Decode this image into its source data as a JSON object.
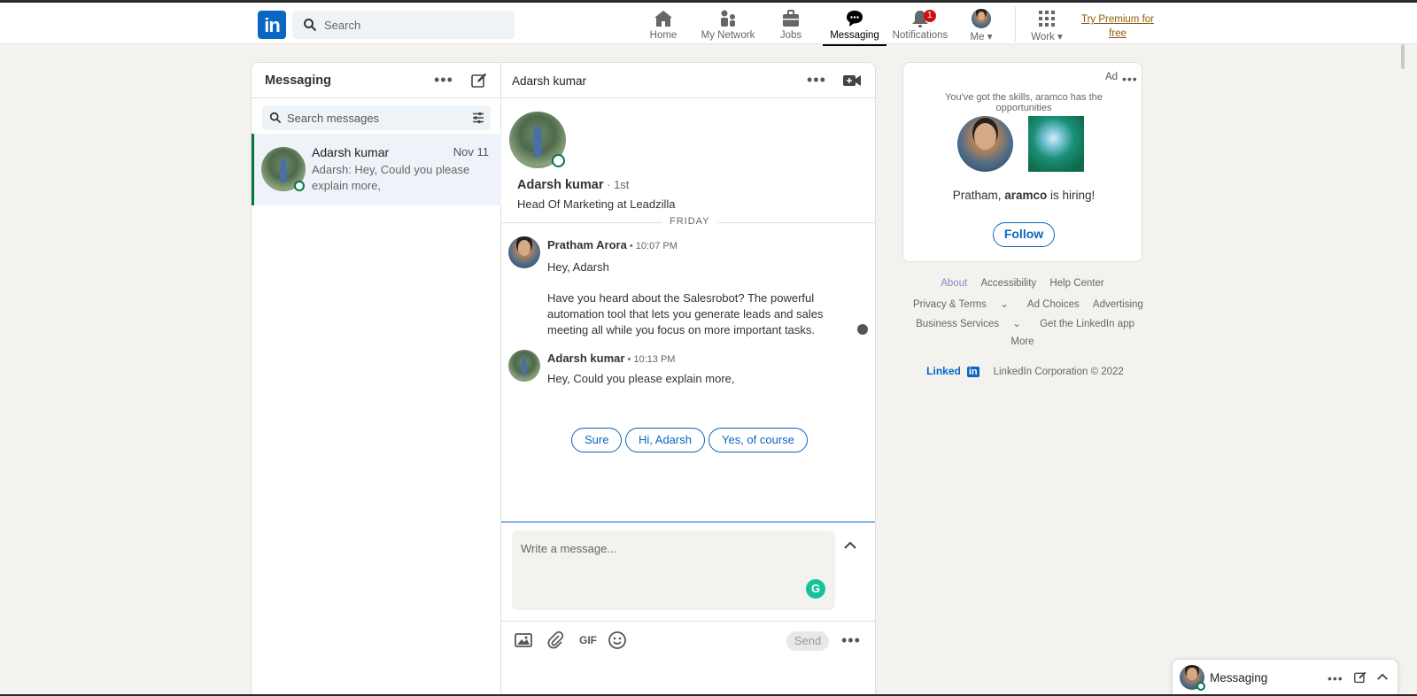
{
  "nav": {
    "search_placeholder": "Search",
    "items": [
      {
        "label": "Home",
        "icon": "home-icon"
      },
      {
        "label": "My Network",
        "icon": "network-icon"
      },
      {
        "label": "Jobs",
        "icon": "briefcase-icon"
      },
      {
        "label": "Messaging",
        "icon": "messaging-icon",
        "active": true
      },
      {
        "label": "Notifications",
        "icon": "bell-icon",
        "badge": "1"
      },
      {
        "label": "Me",
        "icon": "avatar"
      },
      {
        "label": "Work",
        "icon": "grid-icon"
      }
    ],
    "premium": "Try Premium for free"
  },
  "messaging": {
    "title": "Messaging",
    "search_placeholder": "Search messages",
    "conversations": [
      {
        "name": "Adarsh kumar",
        "date": "Nov 11",
        "snippet": "Adarsh: Hey, Could you please explain more,"
      }
    ]
  },
  "chat": {
    "title": "Adarsh kumar",
    "profile": {
      "name": "Adarsh kumar",
      "degree": " · 1st",
      "headline": "Head Of Marketing at Leadzilla"
    },
    "day": "FRIDAY",
    "messages": [
      {
        "sender": "Pratham Arora",
        "time": " • 10:07 PM",
        "lines": [
          "Hey, Adarsh",
          "Have you heard about the Salesrobot? The powerful automation tool that lets you generate leads and sales meeting all while you focus on more important tasks."
        ]
      },
      {
        "sender": "Adarsh kumar",
        "time": " • 10:13 PM",
        "lines": [
          "Hey, Could you please explain more,"
        ]
      }
    ],
    "quick_replies": [
      "Sure",
      "Hi, Adarsh",
      "Yes, of course"
    ],
    "composer_placeholder": "Write a message...",
    "gif_label": "GIF",
    "send_label": "Send"
  },
  "ad": {
    "label": "Ad",
    "tagline": "You've got the skills, aramco has the opportunities",
    "hiring_prefix": "Pratham, ",
    "hiring_company": "aramco",
    "hiring_suffix": " is hiring!",
    "follow": "Follow"
  },
  "footer": {
    "about": "About",
    "accessibility": "Accessibility",
    "help": "Help Center",
    "privacy": "Privacy & Terms",
    "adchoices": "Ad Choices",
    "advertising": "Advertising",
    "business": "Business Services",
    "getapp": "Get the LinkedIn app",
    "more": "More",
    "logo_text": "Linked",
    "logo_in": "in",
    "copyright": "LinkedIn Corporation © 2022"
  },
  "floatbar": {
    "title": "Messaging"
  },
  "colors": {
    "brand": "#0a66c2",
    "online": "#057642",
    "badge": "#cc1016",
    "premium": "#915907"
  }
}
